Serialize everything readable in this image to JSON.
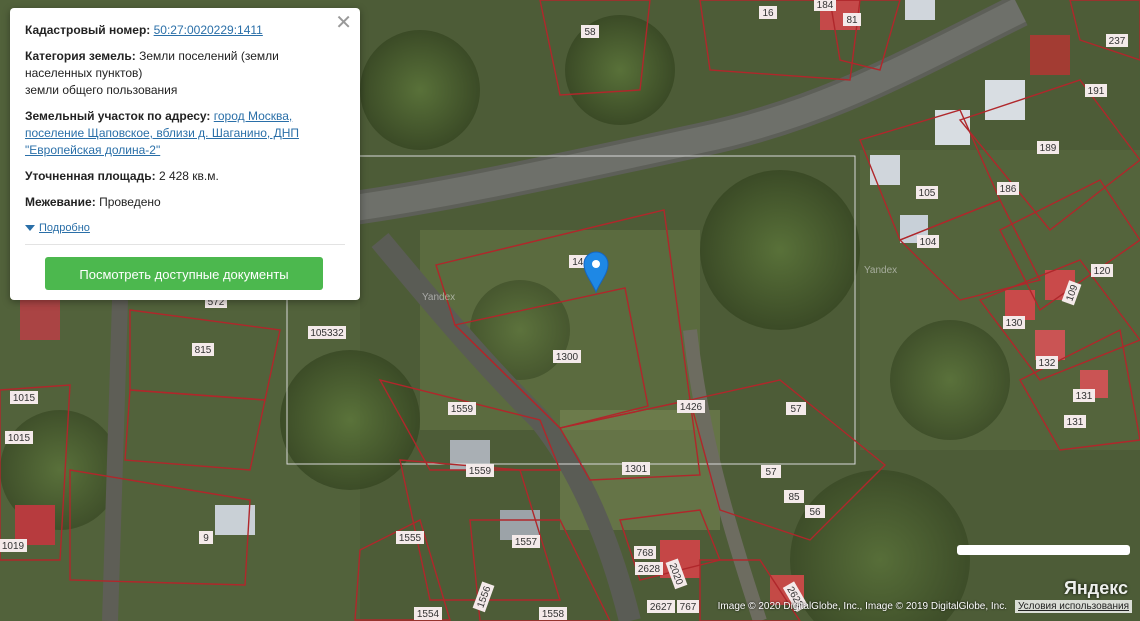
{
  "panel": {
    "cadastral_label": "Кадастровый номер:",
    "cadastral_value": "50:27:0020229:1411",
    "category_label": "Категория земель:",
    "category_value": "Земли поселений (земли населенных пунктов)",
    "category_sub": "земли общего пользования",
    "address_label": "Земельный участок по адресу:",
    "address_value": "город Москва, поселение Щаповское, вблизи д. Шаганино, ДНП \"Европейская долина-2\"",
    "area_label": "Уточненная площадь:",
    "area_value": "2 428 кв.м.",
    "survey_label": "Межевание:",
    "survey_value": "Проведено",
    "more_label": "Подробно",
    "docs_button": "Посмотреть доступные документы",
    "close_icon": "close-icon"
  },
  "parcels": [
    "1411",
    "1300",
    "1426",
    "1301",
    "1559",
    "1559",
    "1557",
    "1555",
    "1556",
    "1554",
    "1558",
    "57",
    "57",
    "85",
    "56",
    "768",
    "2628",
    "2627",
    "767",
    "2020",
    "2623",
    "105332",
    "815",
    "572",
    "1015",
    "1015",
    "1019",
    "9",
    "58",
    "16",
    "184",
    "81",
    "237",
    "191",
    "189",
    "186",
    "105",
    "104",
    "120",
    "109",
    "130",
    "132",
    "131",
    "131"
  ],
  "watermark": "Yandex",
  "footer": {
    "copyright": "Image © 2020 DigitalGlobe, Inc., Image © 2019 DigitalGlobe, Inc.",
    "terms": "Условия использования",
    "logo": "Яндекс"
  },
  "colors": {
    "parcel_border": "#b0272b",
    "button": "#4cb84e",
    "link": "#2a6fa8"
  }
}
